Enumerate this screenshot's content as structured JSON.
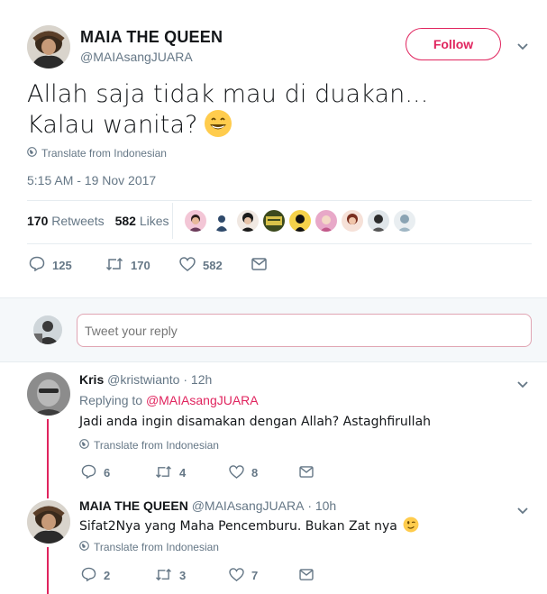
{
  "tweet": {
    "author_name": "MAIA THE QUEEN",
    "author_handle": "@MAIAsangJUARA",
    "follow_label": "Follow",
    "text": "Allah saja tidak mau di duakan... Kalau wanita?",
    "translate_label": "Translate from Indonesian",
    "timestamp": "5:15 AM - 19 Nov 2017",
    "retweets_count": "170",
    "retweets_label": "Retweets",
    "likes_count": "582",
    "likes_label": "Likes",
    "actions": {
      "replies": "125",
      "retweets": "170",
      "likes": "582"
    }
  },
  "reply_box": {
    "placeholder": "Tweet your reply"
  },
  "replies": [
    {
      "name": "Kris",
      "handle": "@kristwianto",
      "time": "· 12h",
      "replying_prefix": "Replying to",
      "replying_to": "@MAIAsangJUARA",
      "text": "Jadi anda ingin disamakan dengan Allah?  Astaghfirullah",
      "translate_label": "Translate from Indonesian",
      "actions": {
        "replies": "6",
        "retweets": "4",
        "likes": "8"
      }
    },
    {
      "name": "MAIA THE QUEEN",
      "handle": "@MAIAsangJUARA",
      "time": "· 10h",
      "text": "Sifat2Nya yang Maha Pencemburu. Bukan Zat nya",
      "translate_label": "Translate from Indonesian",
      "actions": {
        "replies": "2",
        "retweets": "3",
        "likes": "7"
      }
    }
  ],
  "colors": {
    "accent": "#e0245e",
    "muted": "#657786",
    "text": "#14171a"
  }
}
